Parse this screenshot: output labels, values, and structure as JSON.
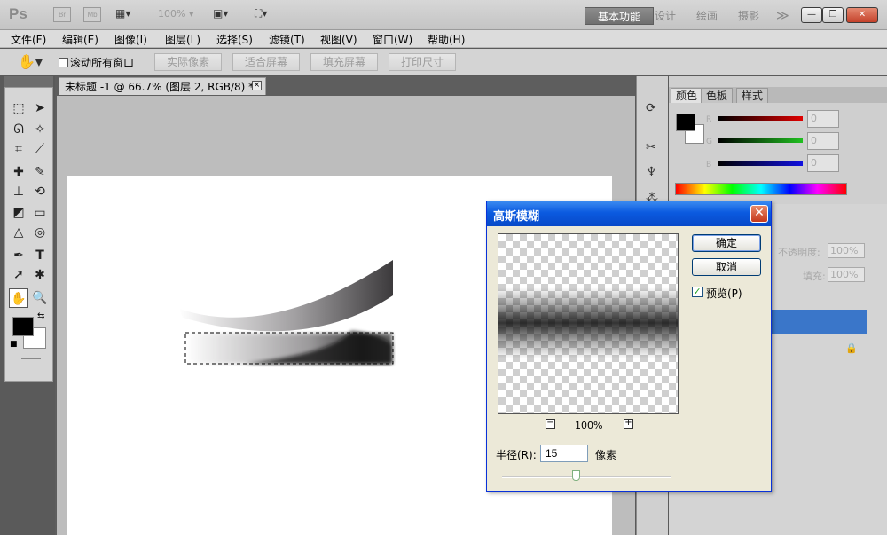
{
  "app": {
    "logo": "Ps",
    "bridge_icon": "Br",
    "minibridge_icon": "Mb",
    "zoom": "100%",
    "workspaces": [
      "基本功能",
      "设计",
      "绘画",
      "摄影"
    ],
    "more": "≫",
    "window_buttons": [
      "—",
      "❐",
      "✕"
    ]
  },
  "menu": [
    "文件(F)",
    "编辑(E)",
    "图像(I)",
    "图层(L)",
    "选择(S)",
    "滤镜(T)",
    "视图(V)",
    "窗口(W)",
    "帮助(H)"
  ],
  "options": {
    "scroll_all_label": "滚动所有窗口",
    "buttons": [
      "实际像素",
      "适合屏幕",
      "填充屏幕",
      "打印尺寸"
    ]
  },
  "document": {
    "tab_title": "未标题 -1 @ 66.7% (图层 2, RGB/8) *"
  },
  "color_panel": {
    "tabs": [
      "颜色",
      "色板",
      "样式"
    ],
    "channels": [
      {
        "label": "R",
        "value": "0",
        "color": "#e00000"
      },
      {
        "label": "G",
        "value": "0",
        "color": "#20c020"
      },
      {
        "label": "B",
        "value": "0",
        "color": "#1010e0"
      }
    ]
  },
  "layers_panel": {
    "opacity_label": "不透明度:",
    "opacity_value": "100%",
    "fill_label": "填充:",
    "fill_value": "100%"
  },
  "dialog": {
    "title": "高斯模糊",
    "ok": "确定",
    "cancel": "取消",
    "preview_label": "预览(P)",
    "zoom_out": "−",
    "zoom_in": "+",
    "zoom_level": "100%",
    "radius_label": "半径(R):",
    "radius_value": "15",
    "radius_unit": "像素"
  }
}
